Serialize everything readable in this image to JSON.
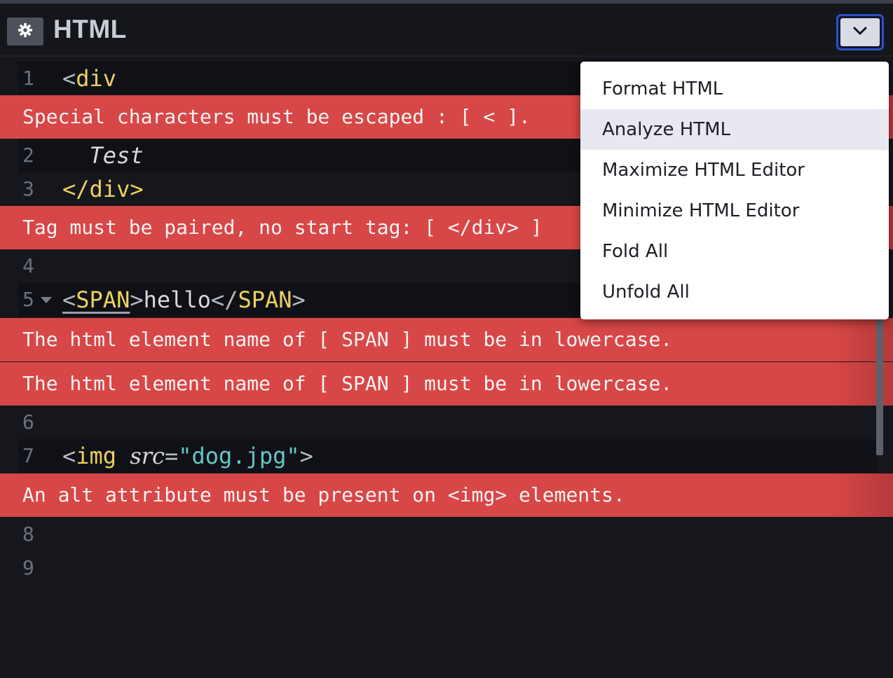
{
  "header": {
    "title": "HTML",
    "settings_icon": "gear-icon",
    "dropdown_icon": "chevron-down-icon"
  },
  "editor": {
    "lines": [
      {
        "number": "1",
        "open": "<",
        "tag": "div"
      },
      {
        "number": "2",
        "text": "  Test"
      },
      {
        "number": "3",
        "text": "</div>"
      },
      {
        "number": "4"
      },
      {
        "number": "5",
        "lt1": "<",
        "tag1": "SPAN",
        "gt1": ">",
        "content": "hello",
        "lt2": "</",
        "tag2": "SPAN",
        "gt2": ">"
      },
      {
        "number": "6"
      },
      {
        "number": "7",
        "lt": "<",
        "tag": "img",
        "attr": "src",
        "eq": "=",
        "value": "\"dog.jpg\"",
        "gt": ">"
      },
      {
        "number": "8"
      },
      {
        "number": "9"
      }
    ],
    "errors": [
      "Special characters must be escaped : [ < ].",
      "Tag must be paired, no start tag: [ </div> ]",
      "The html element name of [ SPAN ] must be in lowercase.",
      "The html element name of [ SPAN ] must be in lowercase.",
      "An alt attribute must be present on <img> elements."
    ]
  },
  "menu": {
    "items": [
      {
        "label": "Format HTML"
      },
      {
        "label": "Analyze HTML"
      },
      {
        "label": "Maximize HTML Editor"
      },
      {
        "label": "Minimize HTML Editor"
      },
      {
        "label": "Fold All"
      },
      {
        "label": "Unfold All"
      }
    ]
  },
  "colors": {
    "error_bg": "#d84747",
    "tag": "#ecd062",
    "string": "#62c7c3",
    "accent_border": "#2c52c9"
  }
}
